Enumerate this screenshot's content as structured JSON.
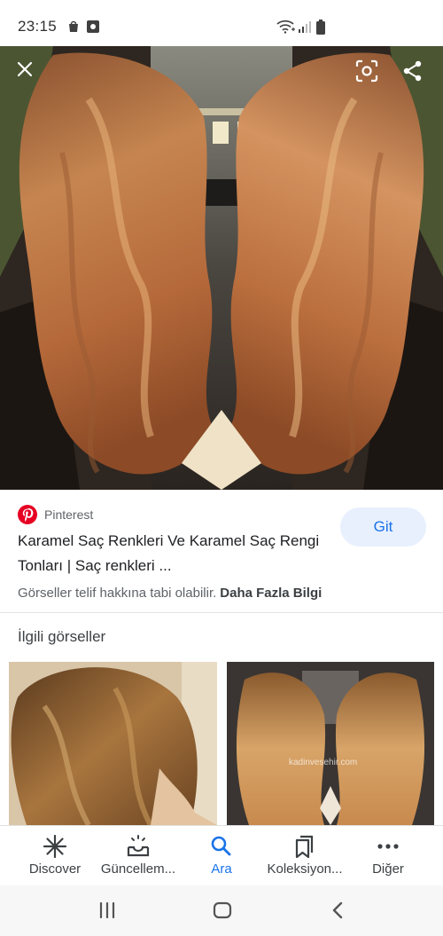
{
  "status_bar": {
    "time": "23:15"
  },
  "hero": {
    "image": "mirrored caramel wavy hair photo"
  },
  "source": {
    "name": "Pinterest",
    "icon": "pinterest-icon",
    "color": "#e60023"
  },
  "result": {
    "title": "Karamel Saç Renkleri Ve Karamel Saç Rengi Tonları | Saç renkleri ...",
    "go_label": "Git",
    "copyright_text": "Görseller telif hakkına tabi olabilir.",
    "more_info_label": "Daha Fazla Bilgi"
  },
  "related": {
    "heading": "İlgili görseller",
    "thumb2_watermark": "kadinvesehir.com"
  },
  "bottom_nav": [
    {
      "label": "Discover",
      "icon": "asterisk-icon"
    },
    {
      "label": "Güncellem...",
      "icon": "inbox-icon"
    },
    {
      "label": "Ara",
      "icon": "search-icon",
      "active": true
    },
    {
      "label": "Koleksiyon...",
      "icon": "collections-icon"
    },
    {
      "label": "Diğer",
      "icon": "more-dots-icon"
    }
  ],
  "colors": {
    "accent": "#1a73e8",
    "go_bg": "#e8f0fe"
  }
}
